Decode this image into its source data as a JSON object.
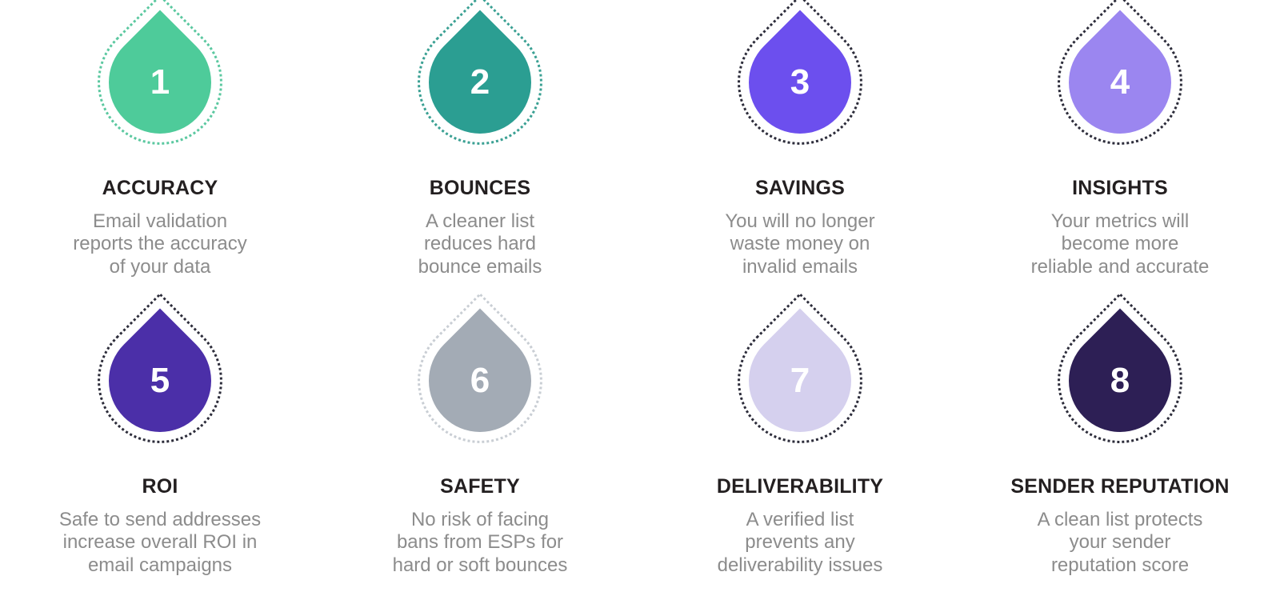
{
  "page": {
    "background_color": "#ffffff",
    "title_color": "#231f20",
    "description_color": "#8c8c8c",
    "number_color": "#ffffff",
    "columns": 4,
    "rows": 2
  },
  "items": [
    {
      "number": "1",
      "title": "ACCURACY",
      "description": "Email validation reports the accuracy of your data",
      "lines": [
        "Email validation",
        "reports the accuracy",
        "of your data"
      ],
      "fill_color": "#4ECB9A",
      "ring_color": "#5BC8A0"
    },
    {
      "number": "2",
      "title": "BOUNCES",
      "description": "A cleaner list reduces hard bounce emails",
      "lines": [
        "A cleaner list",
        "reduces hard",
        "bounce emails"
      ],
      "fill_color": "#2B9E92",
      "ring_color": "#3AA093"
    },
    {
      "number": "3",
      "title": "SAVINGS",
      "description": "You will no longer waste money on invalid emails",
      "lines": [
        "You will no longer",
        "waste money on",
        "invalid emails"
      ],
      "fill_color": "#6C4FEE",
      "ring_color": "#2C2C3A"
    },
    {
      "number": "4",
      "title": "INSIGHTS",
      "description": "Your metrics will become more reliable and accurate",
      "lines": [
        "Your metrics will",
        "become more",
        "reliable and accurate"
      ],
      "fill_color": "#9B86F0",
      "ring_color": "#2C2C3A"
    },
    {
      "number": "5",
      "title": "ROI",
      "description": "Safe to send addresses increase overall ROI in email campaigns",
      "lines": [
        "Safe to send addresses",
        "increase overall ROI in",
        "email campaigns"
      ],
      "fill_color": "#4B2FA8",
      "ring_color": "#2C2C3A"
    },
    {
      "number": "6",
      "title": "SAFETY",
      "description": "No risk of facing bans from ESPs for hard or soft bounces",
      "lines": [
        "No risk of facing",
        "bans from ESPs for",
        "hard or soft bounces"
      ],
      "fill_color": "#A3ABB5",
      "ring_color": "#C9CED4"
    },
    {
      "number": "7",
      "title": "DELIVERABILITY",
      "description": "A verified list prevents any deliverability issues",
      "lines": [
        "A verified list",
        "prevents any",
        "deliverability issues"
      ],
      "fill_color": "#D5D0EE",
      "ring_color": "#2C2C3A"
    },
    {
      "number": "8",
      "title": "SENDER REPUTATION",
      "description": "A clean list protects your sender reputation score",
      "lines": [
        "A clean list protects",
        "your sender",
        "reputation score"
      ],
      "fill_color": "#2D1F55",
      "ring_color": "#2C2C3A"
    }
  ]
}
